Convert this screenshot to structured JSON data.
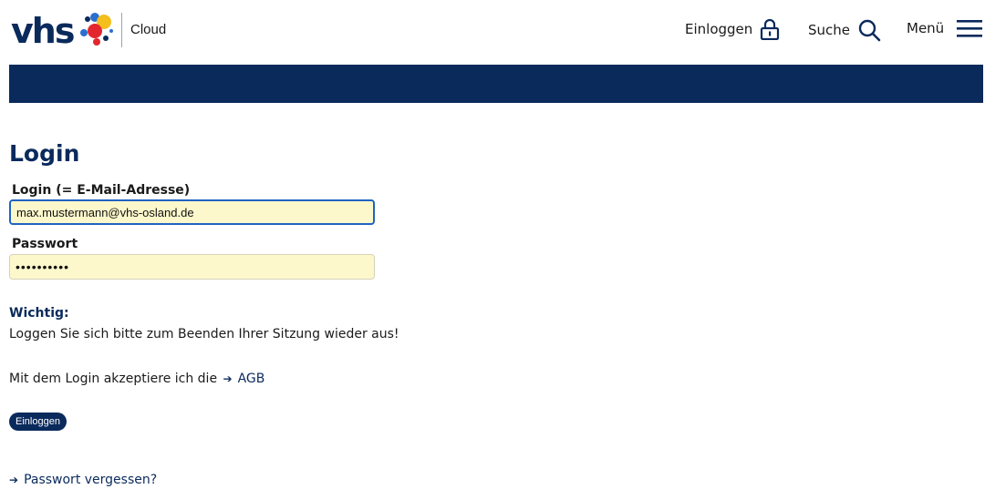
{
  "header": {
    "logo_text": "vhs",
    "subtitle": "Cloud",
    "nav": {
      "login_label": "Einloggen",
      "search_label": "Suche",
      "menu_label": "Menü"
    },
    "icons": {
      "login": "lock-icon",
      "search": "search-icon",
      "menu": "hamburger-icon"
    }
  },
  "colors": {
    "brand_navy": "#0a2a5c",
    "input_bg": "#fdf8cc",
    "focus_border": "#1f64c4"
  },
  "main": {
    "title": "Login",
    "form": {
      "email_label": "Login (= E-Mail-Adresse)",
      "email_value": "max.mustermann@vhs-osland.de",
      "password_label": "Passwort",
      "password_value": "••••••••••"
    },
    "important": {
      "title": "Wichtig:",
      "text": "Loggen Sie sich bitte zum Beenden Ihrer Sitzung wieder aus!"
    },
    "terms": {
      "text": "Mit dem Login akzeptiere ich die",
      "link": "AGB"
    },
    "submit_label": "Einloggen",
    "forgot_link": "Passwort vergessen?"
  }
}
